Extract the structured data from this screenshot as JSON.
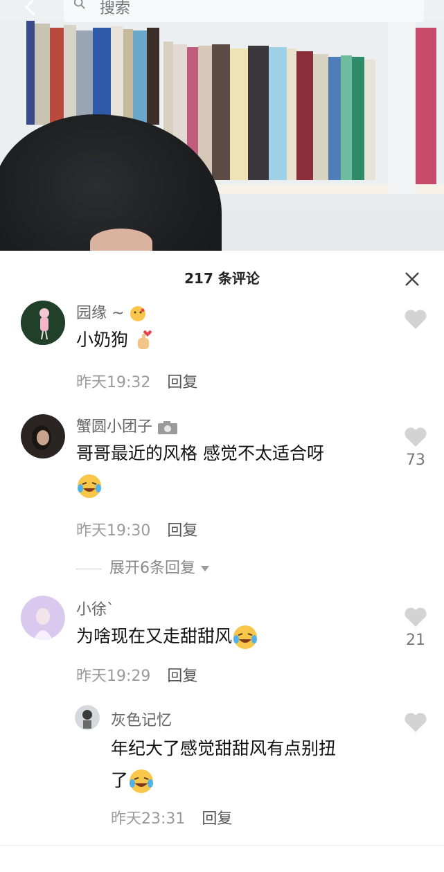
{
  "search": {
    "placeholder": "搜索"
  },
  "panel": {
    "title": "217 条评论"
  },
  "comments": [
    {
      "name": "园缘 ~",
      "text": "小奶狗",
      "time": "昨天19:32",
      "reply": "回复",
      "likes": ""
    },
    {
      "name": "蟹圆小团子",
      "text_line1": "哥哥最近的风格 感觉不太适合呀",
      "time": "昨天19:30",
      "reply": "回复",
      "likes": "73",
      "expand": "展开6条回复"
    },
    {
      "name": "小徐`",
      "text": "为啥现在又走甜甜风",
      "time": "昨天19:29",
      "reply": "回复",
      "likes": "21"
    },
    {
      "name": "灰色记忆",
      "text_line1": "年纪大了感觉甜甜风有点别扭",
      "text_line2": "了",
      "time": "昨天23:31",
      "reply": "回复",
      "likes": ""
    }
  ],
  "colors": {
    "accent_text": "#111111",
    "muted": "#9a9a9a",
    "heart": "#d3d3d3"
  }
}
